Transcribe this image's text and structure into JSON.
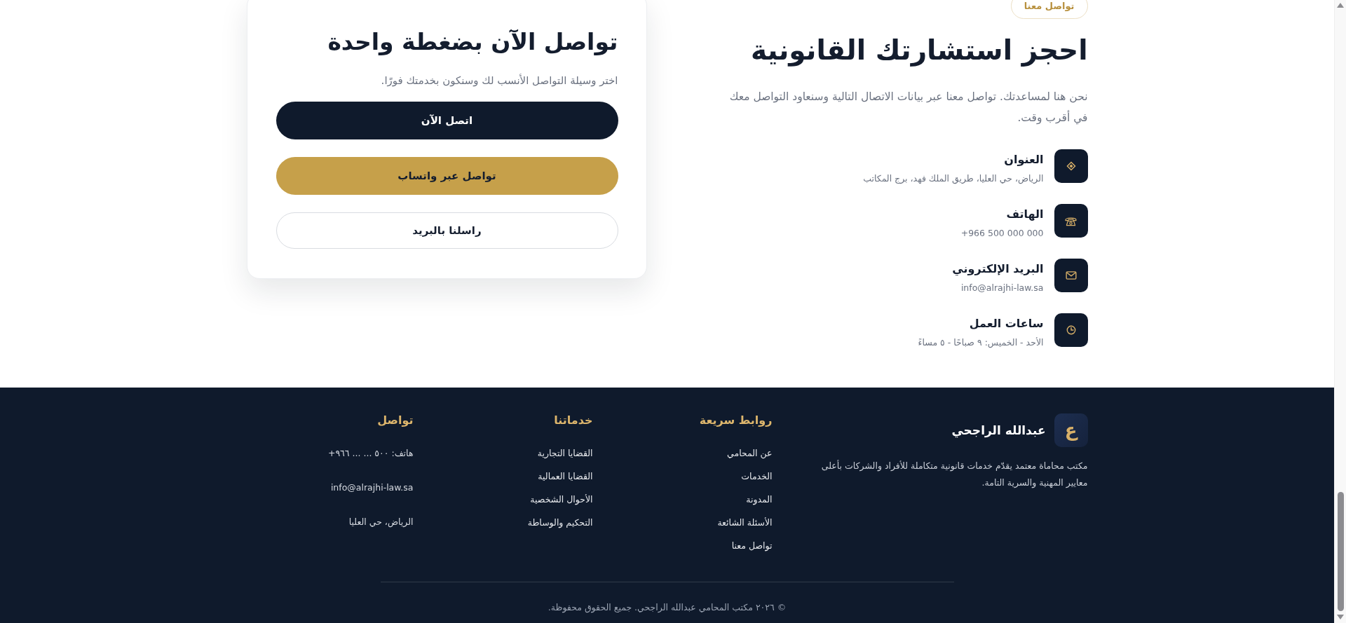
{
  "contact_section": {
    "badge": "تواصل معنا",
    "heading": "احجز استشارتك القانونية",
    "intro": "نحن هنا لمساعدتك. تواصل معنا عبر بيانات الاتصال التالية وسنعاود التواصل معك في أقرب وقت.",
    "items": [
      {
        "kind": "address",
        "title": "العنوان",
        "value": "الرياض، حي العليا، طريق الملك فهد، برج المكاتب"
      },
      {
        "kind": "phone",
        "title": "الهاتف",
        "value": "+966 500 000 000"
      },
      {
        "kind": "email",
        "title": "البريد الإلكتروني",
        "value": "info@alrajhi-law.sa"
      },
      {
        "kind": "hours",
        "title": "ساعات العمل",
        "value": "الأحد - الخميس: ٩ صباحًا - ٥ مساءً"
      }
    ]
  },
  "quick_contact_card": {
    "title": "تواصل الآن بضغطة واحدة",
    "subtitle": "اختر وسيلة التواصل الأنسب لك وسنكون بخدمتك فورًا.",
    "buttons": [
      {
        "kind": "primary",
        "label": "اتصل الآن"
      },
      {
        "kind": "accent",
        "label": "تواصل عبر واتساب"
      },
      {
        "kind": "outline",
        "label": "راسلنا بالبريد"
      }
    ]
  },
  "footer": {
    "brand": {
      "logo_letter": "ع",
      "name": "عبدالله الراجحي",
      "description": "مكتب محاماة معتمد يقدّم خدمات قانونية متكاملة للأفراد والشركات بأعلى معايير المهنية والسرية التامة."
    },
    "columns": [
      {
        "kind": "links",
        "heading": "روابط سريعة",
        "items": [
          "عن المحامي",
          "الخدمات",
          "المدونة",
          "الأسئلة الشائعة",
          "تواصل معنا"
        ]
      },
      {
        "kind": "links",
        "heading": "خدماتنا",
        "items": [
          "القضايا التجارية",
          "القضايا العمالية",
          "الأحوال الشخصية",
          "التحكيم والوساطة"
        ]
      },
      {
        "kind": "contact",
        "heading": "تواصل",
        "items": [
          "هاتف: ٥٠٠ ... ... ٩٦٦+",
          "info@alrajhi-law.sa",
          "الرياض، حي العليا"
        ]
      }
    ],
    "copyright": "© ٢٠٢٦ مكتب المحامي عبدالله الراجحي. جميع الحقوق محفوظة."
  }
}
